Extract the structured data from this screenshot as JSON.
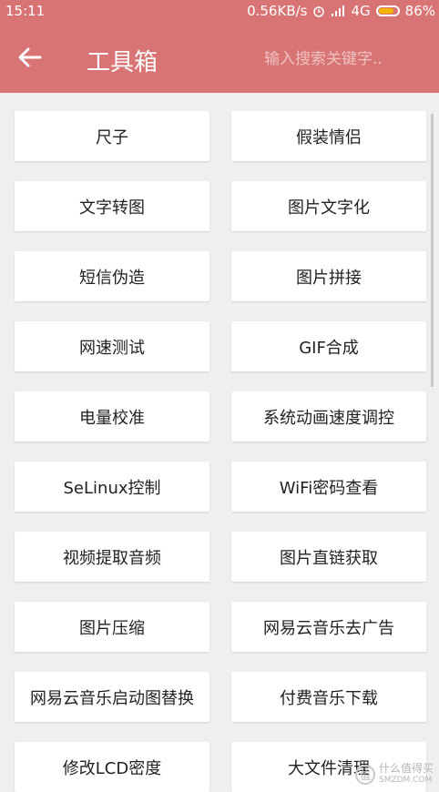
{
  "status_bar": {
    "time": "15:11",
    "speed": "0.56KB/s",
    "network": "4G",
    "battery": "86%",
    "battery_level": 0.86
  },
  "appbar": {
    "title": "工具箱",
    "search_placeholder": "输入搜索关键字..",
    "color": "#d97474"
  },
  "tools": [
    "尺子",
    "假装情侣",
    "文字转图",
    "图片文字化",
    "短信伪造",
    "图片拼接",
    "网速测试",
    "GIF合成",
    "电量校准",
    "系统动画速度调控",
    "SeLinux控制",
    "WiFi密码查看",
    "视频提取音频",
    "图片直链获取",
    "图片压缩",
    "网易云音乐去广告",
    "网易云音乐启动图替换",
    "付费音乐下载",
    "修改LCD密度",
    "大文件清理"
  ],
  "watermark": {
    "text": "什么值得买",
    "sub": "SMZDM.COM",
    "logo_char": "值"
  }
}
